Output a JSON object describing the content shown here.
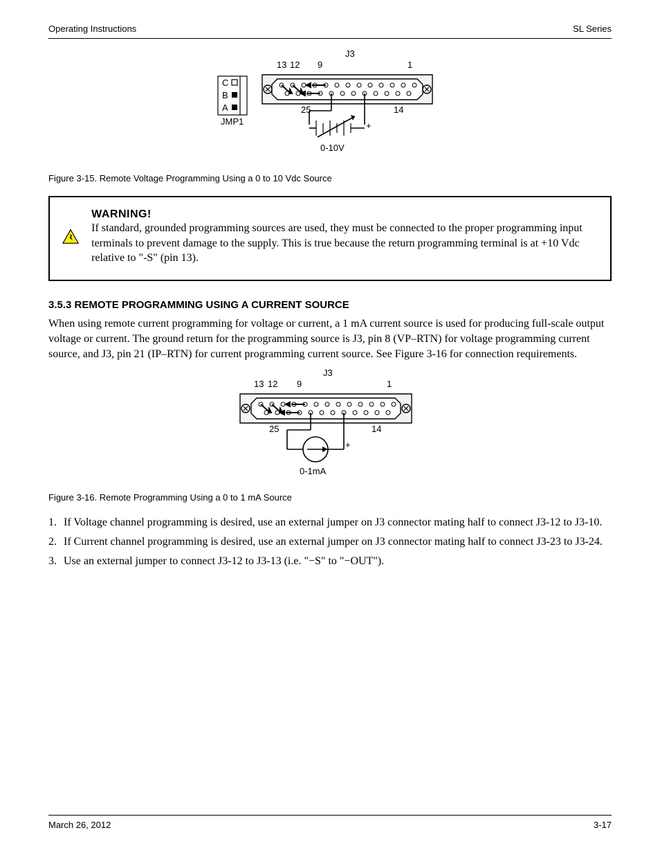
{
  "header": {
    "left": "Operating Instructions",
    "right": "SL Series"
  },
  "figure1": {
    "caption": "Figure 3-15. Remote Voltage Programming Using a 0 to 10 Vdc Source",
    "jmp_label": "JMP1",
    "jmp_c": "C",
    "jmp_b": "B",
    "jmp_a": "A",
    "conn_label": "J3",
    "p13": "13",
    "p12": "12",
    "p9": "9",
    "p1": "1",
    "p25": "25",
    "p14": "14",
    "src_label": "0-10V",
    "src_plus": "+"
  },
  "warning": {
    "head": "WARNING!",
    "text": "If standard, grounded programming sources are used, they must be connected to the proper programming input terminals to prevent damage to the supply. This is true because the return programming terminal is at +10 Vdc relative to \"-S\" (pin 13)."
  },
  "section": {
    "title": "3.5.3  REMOTE PROGRAMMING USING A CURRENT SOURCE",
    "para": "When using remote current programming for voltage or current, a 1 mA current source is used for producing full-scale output voltage or current. The ground return for the programming source is J3, pin 8 (VP–RTN) for voltage programming current source, and J3, pin 21 (IP–RTN) for current programming current source. See Figure 3-16 for connection requirements."
  },
  "figure2": {
    "caption": "Figure 3-16. Remote Programming Using a 0 to 1 mA Source",
    "conn_label": "J3",
    "p13": "13",
    "p12": "12",
    "p9": "9",
    "p1": "1",
    "p25": "25",
    "p14": "14",
    "src_label": "0-1mA",
    "src_plus": "+"
  },
  "list": {
    "item1_lead": "1.",
    "item1": "If Voltage channel programming is desired, use an external jumper on J3 connector mating half to connect J3-12 to J3-10.",
    "item2_lead": "2.",
    "item2": "If Current channel programming is desired, use an external jumper on J3 connector mating half to connect J3-23 to J3-24.",
    "item3_lead": "3.",
    "item3": "Use an external jumper to connect J3-12 to J3-13 (i.e. \"−S\" to \"−OUT\")."
  },
  "footer": {
    "revdate": "March 26, 2012",
    "page": "3-17"
  }
}
